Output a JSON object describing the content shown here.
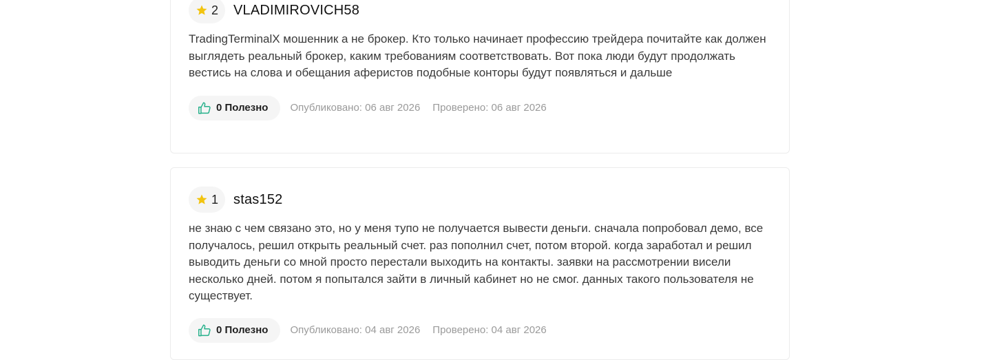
{
  "colors": {
    "star": "#f2c40f",
    "like_icon": "#25b08a",
    "pill_bg": "#f5f5f5",
    "meta_text": "#9a9a9a"
  },
  "reviews": [
    {
      "rating": "2",
      "username": "VLADIMIROVICH58",
      "text": "TradingTerminalX мошенник а не брокер. Кто только начинает профессию трейдера почитайте как должен выглядеть реальный брокер, каким требованиям соответствовать. Вот пока люди будут продолжать вестись на слова и обещания аферистов подобные конторы будут появляться и дальше",
      "helpful_label": "0 Полезно",
      "published": "Опубликовано: 06 авг 2026",
      "verified": "Проверено: 06 авг 2026"
    },
    {
      "rating": "1",
      "username": "stas152",
      "text": "не знаю с чем связано это, но у меня тупо не получается вывести деньги. сначала попробовал демо, все получалось, решил открыть реальный счет. раз пополнил счет, потом второй. когда заработал и решил выводить деньги со мной просто перестали выходить на контакты. заявки на рассмотрении висели несколько дней. потом я попытался зайти в личный кабинет но не смог. данных такого пользователя не существует.",
      "helpful_label": "0 Полезно",
      "published": "Опубликовано: 04 авг 2026",
      "verified": "Проверено: 04 авг 2026"
    }
  ]
}
